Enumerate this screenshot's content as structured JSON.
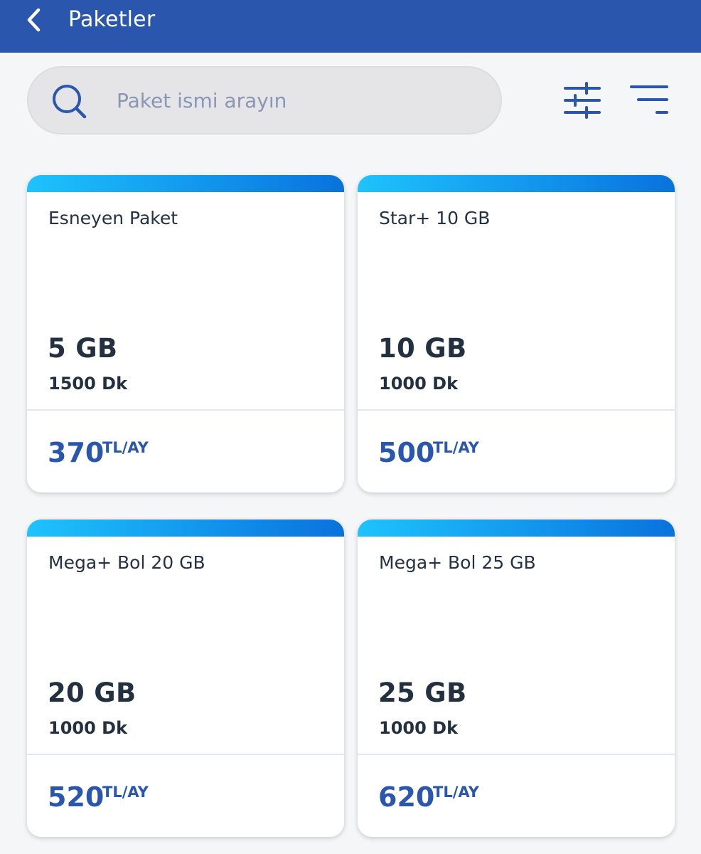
{
  "header": {
    "title": "Paketler",
    "back_icon": "chevron-left-icon"
  },
  "search": {
    "placeholder": "Paket ismi arayın",
    "value": "",
    "icon": "search-icon"
  },
  "toolbar": {
    "filter_icon": "sliders-icon",
    "sort_icon": "sort-lines-icon"
  },
  "colors": {
    "primary": "#2a56ad",
    "card_bar_start": "#1ec3fc",
    "card_bar_end": "#0a72dc",
    "background": "#f5f6f8",
    "text_dark": "#23303f",
    "placeholder": "#8a96b6"
  },
  "packages": [
    {
      "name": "Esneyen Paket",
      "data": "5 GB",
      "minutes": "1500 Dk",
      "price": "370",
      "unit": "TL/AY"
    },
    {
      "name": "Star+ 10 GB",
      "data": "10 GB",
      "minutes": "1000 Dk",
      "price": "500",
      "unit": "TL/AY"
    },
    {
      "name": "Mega+ Bol 20 GB",
      "data": "20 GB",
      "minutes": "1000 Dk",
      "price": "520",
      "unit": "TL/AY"
    },
    {
      "name": "Mega+ Bol 25 GB",
      "data": "25 GB",
      "minutes": "1000 Dk",
      "price": "620",
      "unit": "TL/AY"
    }
  ]
}
